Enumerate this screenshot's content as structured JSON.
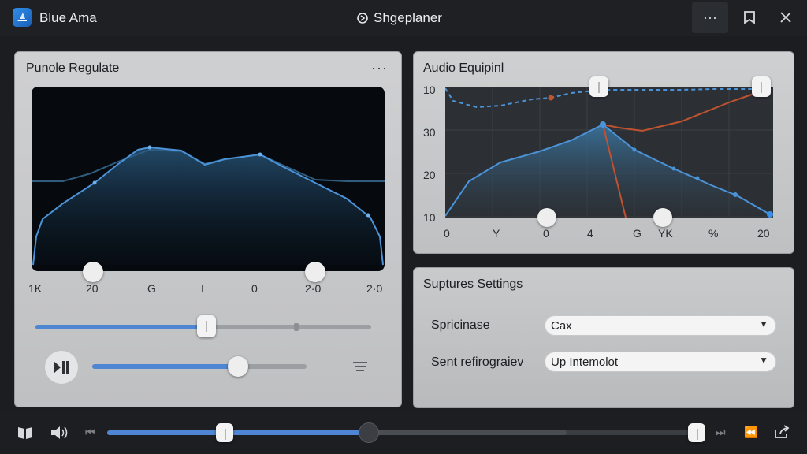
{
  "window": {
    "app_title": "Blue Ama",
    "center_title": "Shgeplaner",
    "more_label": "···"
  },
  "left_panel": {
    "title": "Punole Regulate",
    "menu_label": "···",
    "x_ticks": [
      "1K",
      "20",
      "G",
      "I",
      "0",
      "2·0",
      "2·0"
    ],
    "main_slider_value": 0.51,
    "volume_slider_value": 0.68
  },
  "audio_panel": {
    "title": "Audio Equipinl",
    "y_ticks": [
      "10",
      "30",
      "20",
      "10"
    ],
    "x_ticks": [
      "0",
      "Y",
      "0",
      "4",
      "G",
      "YK",
      "%",
      "20"
    ]
  },
  "settings_panel": {
    "title": "Suptures Settings",
    "fields": [
      {
        "label": "Spricinase",
        "value": "Cax"
      },
      {
        "label": "Sent refirograiev",
        "value": "Up Intemolot"
      }
    ]
  },
  "bottom_bar": {
    "progress_value": 0.78,
    "buffer_value": 0.53
  },
  "colors": {
    "accent": "#4f86d3",
    "graph_bg": "#06090d",
    "curve_blue": "#4b93d8",
    "curve_orange": "#c0532f"
  }
}
